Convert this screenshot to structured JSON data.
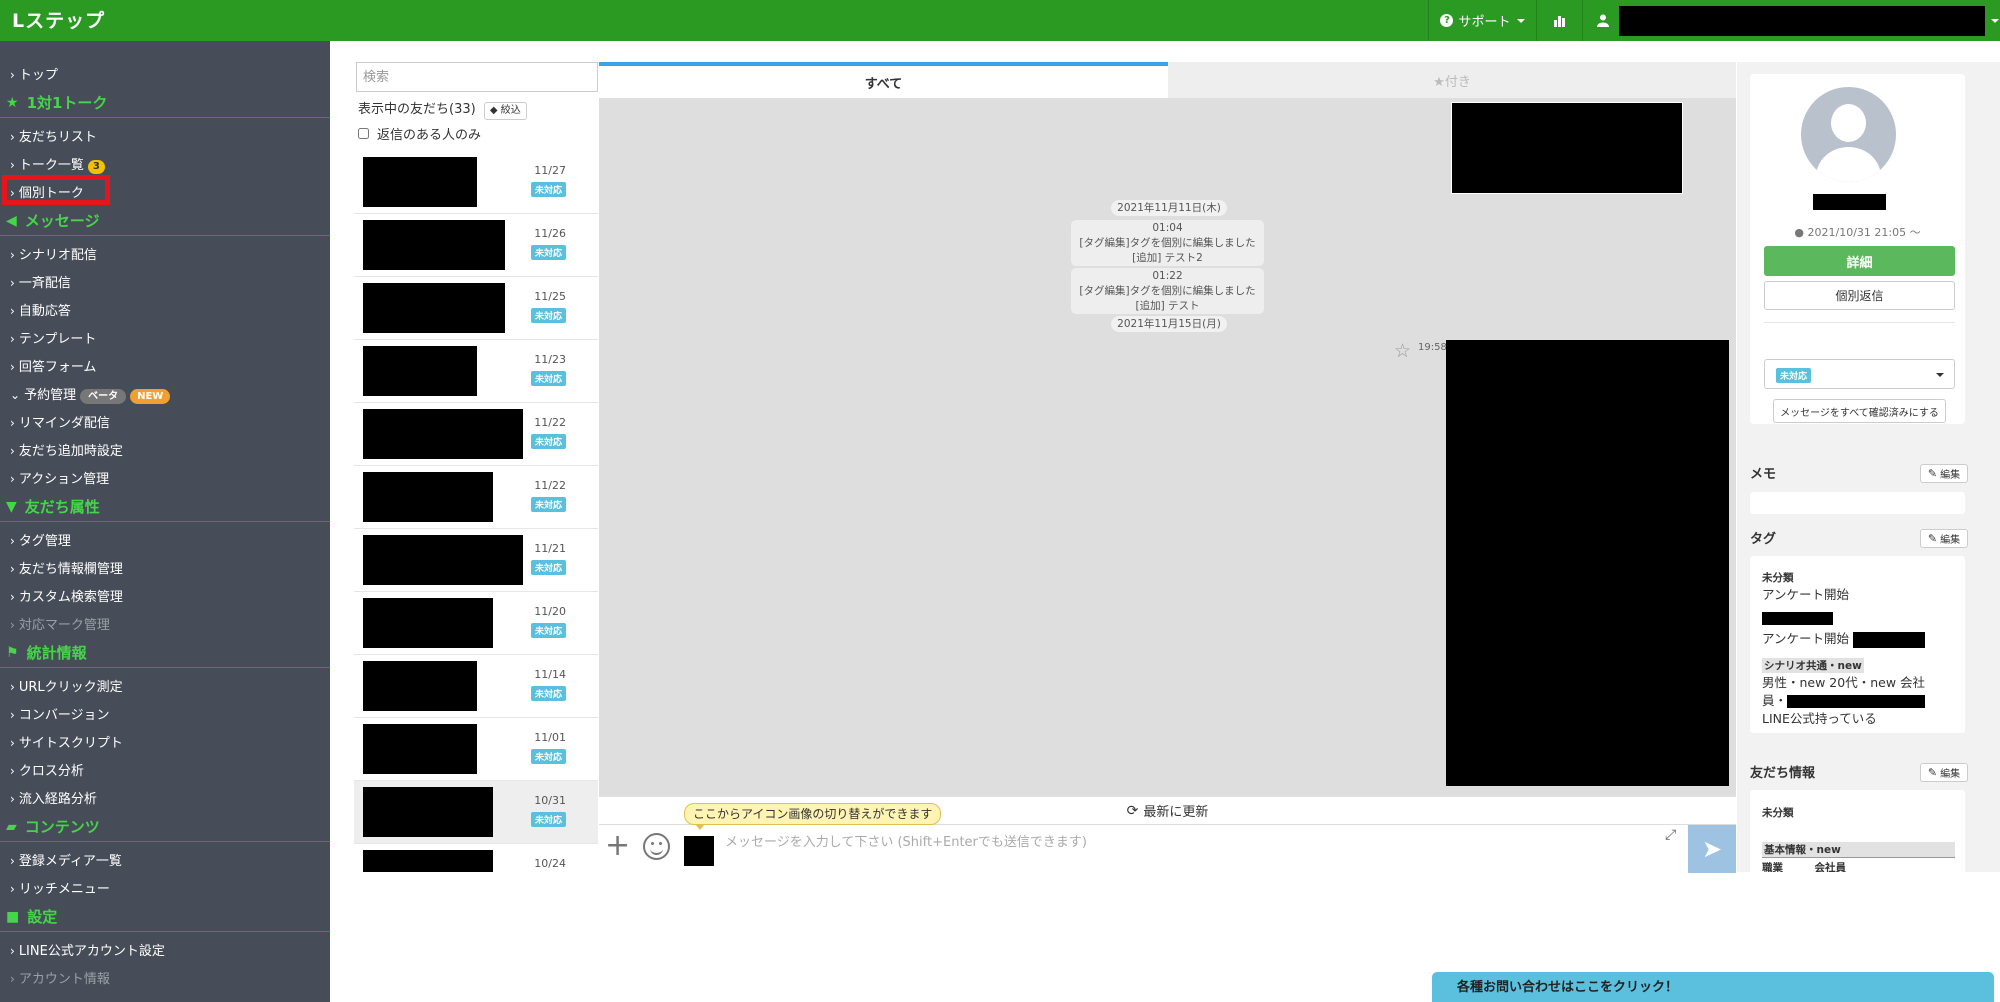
{
  "app": {
    "logo": "Lステップ"
  },
  "topnav": {
    "support_label": "サポート"
  },
  "sidebar": {
    "top": "トップ",
    "sections": [
      {
        "title": "1対1トーク",
        "icon": "star-icon",
        "items": [
          "友だちリスト",
          "トーク一覧",
          "個別トーク"
        ]
      },
      {
        "title": "メッセージ",
        "icon": "megaphone-icon",
        "items": [
          "シナリオ配信",
          "一斉配信",
          "自動応答",
          "テンプレート",
          "回答フォーム",
          "予約管理",
          "リマインダ配信",
          "友だち追加時設定",
          "アクション管理"
        ]
      },
      {
        "title": "友だち属性",
        "icon": "filter-icon",
        "items": [
          "タグ管理",
          "友だち情報欄管理",
          "カスタム検索管理",
          "対応マーク管理"
        ]
      },
      {
        "title": "統計情報",
        "icon": "flag-icon",
        "items": [
          "URLクリック測定",
          "コンバージョン",
          "サイトスクリプト",
          "クロス分析",
          "流入経路分析"
        ]
      },
      {
        "title": "コンテンツ",
        "icon": "folder-icon",
        "items": [
          "登録メディア一覧",
          "リッチメニュー"
        ]
      },
      {
        "title": "設定",
        "icon": "chat-icon",
        "items": [
          "LINE公式アカウント設定",
          "アカウント情報"
        ]
      }
    ],
    "talk_list_badge": "3",
    "reservation_badges": [
      "ベータ",
      "NEW"
    ]
  },
  "friend_panel": {
    "search_placeholder": "検索",
    "count_label": "表示中の友だち(33)",
    "filter_label": "絞込",
    "reply_only_label": "返信のある人のみ",
    "friends": [
      {
        "date": "11/27",
        "status": "未対応"
      },
      {
        "date": "11/26",
        "status": "未対応"
      },
      {
        "date": "11/25",
        "status": "未対応"
      },
      {
        "date": "11/23",
        "status": "未対応"
      },
      {
        "date": "11/22",
        "status": "未対応"
      },
      {
        "date": "11/22",
        "status": "未対応"
      },
      {
        "date": "11/21",
        "status": "未対応"
      },
      {
        "date": "11/20",
        "status": "未対応"
      },
      {
        "date": "11/14",
        "status": "未対応"
      },
      {
        "date": "11/01",
        "status": "未対応"
      },
      {
        "date": "10/31",
        "status": "未対応"
      },
      {
        "date": "10/24",
        "status": ""
      }
    ]
  },
  "chat": {
    "tab_all": "すべて",
    "tab_starred": "★付き",
    "date1": "2021年11月11日(木)",
    "sys1": {
      "time": "01:04",
      "line1": "[タグ編集]タグを個別に編集しました",
      "line2": "[追加] テスト2"
    },
    "sys2": {
      "time": "01:22",
      "line1": "[タグ編集]タグを個別に編集しました",
      "line2": "[追加] テスト"
    },
    "date2": "2021年11月15日(月)",
    "msg_time": "19:58",
    "refresh_label": "最新に更新",
    "tooltip": "ここからアイコン画像の切り替えができます",
    "input_placeholder": "メッセージを入力して下さい (Shift+Enterでも送信できます)"
  },
  "profile": {
    "since": "2021/10/31 21:05 〜",
    "detail_label": "詳細",
    "reply_label": "個別返信",
    "status_value": "未対応",
    "markall_label": "メッセージをすべて確認済みにする",
    "memo_title": "メモ",
    "edit_label": "編集",
    "tag_title": "タグ",
    "tags": {
      "cat1": "未分類",
      "t1": "アンケート開始",
      "t2": "アンケート開始",
      "cat2": "シナリオ共通・new",
      "t3": "男性・new 20代・new 会社",
      "t4": "員・",
      "t5": "LINE公式持っている"
    },
    "friendinfo_title": "友だち情報",
    "fi_uncat": "未分類",
    "fi_basic": "基本情報・new",
    "fi_row": "職業　　　会社員"
  },
  "contact_bar": "各種お問い合わせはここをクリック！",
  "colors": {
    "brand_green": "#2a9a22",
    "sidebar_bg": "#474d58",
    "status_blue": "#5bc0de",
    "highlight_red": "#e8141c"
  }
}
